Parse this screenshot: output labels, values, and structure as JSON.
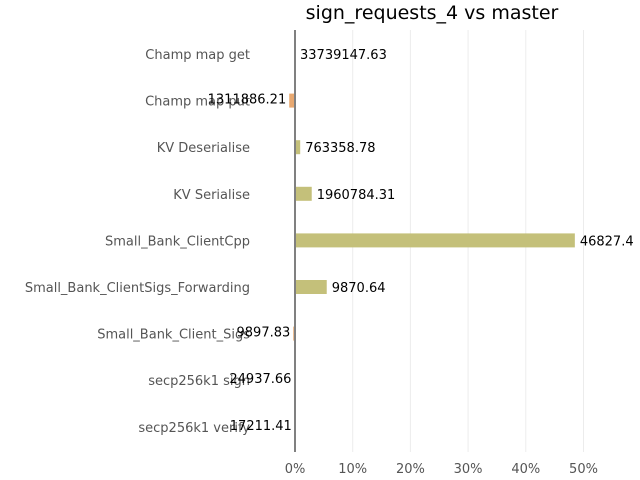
{
  "chart_data": {
    "type": "bar",
    "orientation": "horizontal",
    "title": "sign_requests_4 vs master",
    "xlabel": "",
    "ylabel": "",
    "grid": "vertical gridlines",
    "xlim": [
      -0.02,
      0.6
    ],
    "x_ticks": [
      0,
      0.1,
      0.2,
      0.3,
      0.4,
      0.5
    ],
    "x_tick_labels": [
      "0%",
      "10%",
      "20%",
      "30%",
      "40%",
      "50%"
    ],
    "categories": [
      "Champ map get",
      "Champ map put",
      "KV Deserialise",
      "KV Serialise",
      "Small_Bank_ClientCpp",
      "Small_Bank_ClientSigs_Forwarding",
      "Small_Bank_Client_Sigs",
      "secp256k1 sign",
      "secp256k1 verify"
    ],
    "values": [
      0.0,
      -0.01,
      0.009,
      0.029,
      0.485,
      0.055,
      -0.003,
      -0.001,
      -0.0003
    ],
    "data_labels": [
      "33739147.63",
      "1311886.21",
      "763358.78",
      "1960784.31",
      "46827.4",
      "9870.64",
      "9897.83",
      "24937.66",
      "17211.41"
    ],
    "colors": {
      "positive": "#c4c07a",
      "negative": "#e8a870",
      "axis": "#808080",
      "grid": "#ececec"
    }
  }
}
